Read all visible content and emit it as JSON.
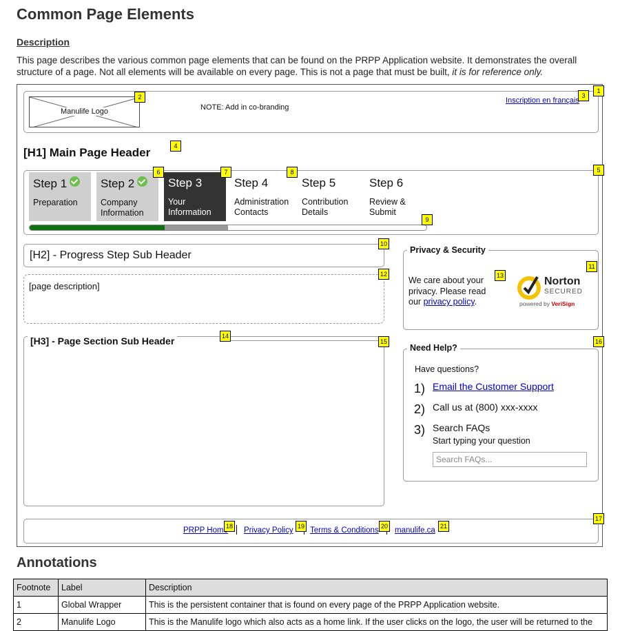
{
  "page": {
    "title": "Common Page Elements",
    "description_heading": "Description",
    "description_text": "This page describes the various common page elements that can be found on the PRPP Application website. It demonstrates the overall structure of a page. Not all elements will be available on every page. This is not a page that must be built,",
    "description_emphasis": "it is for reference only."
  },
  "header": {
    "logo_label": "Manulife Logo",
    "cobranding_note": "NOTE: Add in co-branding",
    "language_link": "Inscription en français"
  },
  "main_header": "[H1] Main Page Header",
  "steps": [
    {
      "title": "Step 1",
      "subtitle": "Preparation",
      "state": "done"
    },
    {
      "title": "Step 2",
      "subtitle": "Company Information",
      "state": "done"
    },
    {
      "title": "Step 3",
      "subtitle": "Your Information",
      "state": "current"
    },
    {
      "title": "Step 4",
      "subtitle": "Administration Contacts",
      "state": "upcoming"
    },
    {
      "title": "Step 5",
      "subtitle": "Contribution Details",
      "state": "upcoming"
    },
    {
      "title": "Step 6",
      "subtitle": "Review & Submit",
      "state": "upcoming"
    }
  ],
  "progress": {
    "completed_fraction": 0.34,
    "in_progress_fraction": 0.5
  },
  "sub_header": "[H2] - Progress Step Sub Header",
  "page_description": "[page description]",
  "section_header": "[H3] - Page Section Sub Header",
  "privacy": {
    "legend": "Privacy & Security",
    "text_before": "We care about your privacy. Please read our",
    "link": "privacy policy",
    "text_after": ".",
    "norton_brand": "Norton",
    "norton_secured": "SECURED",
    "norton_powered": "powered by",
    "norton_verisign": "VeriSign"
  },
  "help": {
    "legend": "Need Help?",
    "intro": "Have questions?",
    "items": [
      {
        "num": "1)",
        "text": "Email the Customer Support",
        "is_link": true
      },
      {
        "num": "2)",
        "text": "Call us at (800) xxx-xxxx",
        "is_link": false
      },
      {
        "num": "3)",
        "text": "Search FAQs",
        "is_link": false
      }
    ],
    "search_hint": "Start typing your question",
    "search_placeholder": "Search FAQs..."
  },
  "footer_links": [
    "PRPP Home",
    "Privacy Policy",
    "Terms & Conditions",
    "manulife.ca"
  ],
  "badges": [
    "1",
    "2",
    "3",
    "4",
    "5",
    "6",
    "7",
    "8",
    "9",
    "10",
    "11",
    "12",
    "13",
    "14",
    "15",
    "16",
    "17",
    "18",
    "19",
    "20",
    "21"
  ],
  "annotations": {
    "title": "Annotations",
    "headers": [
      "Footnote",
      "Label",
      "Description"
    ],
    "rows": [
      [
        "1",
        "Global Wrapper",
        "This is the persistent container that is found on every page of the PRPP Application website."
      ],
      [
        "2",
        "Manulife Logo",
        "This is the Manulife logo which also acts as a home link. If the user clicks on the logo, the user will be returned to the"
      ]
    ]
  },
  "colors": {
    "badge": "#ffff00",
    "progress_done": "#107010",
    "step_current": "#333333",
    "step_done": "#cfcfcf",
    "link": "#0000cc"
  }
}
